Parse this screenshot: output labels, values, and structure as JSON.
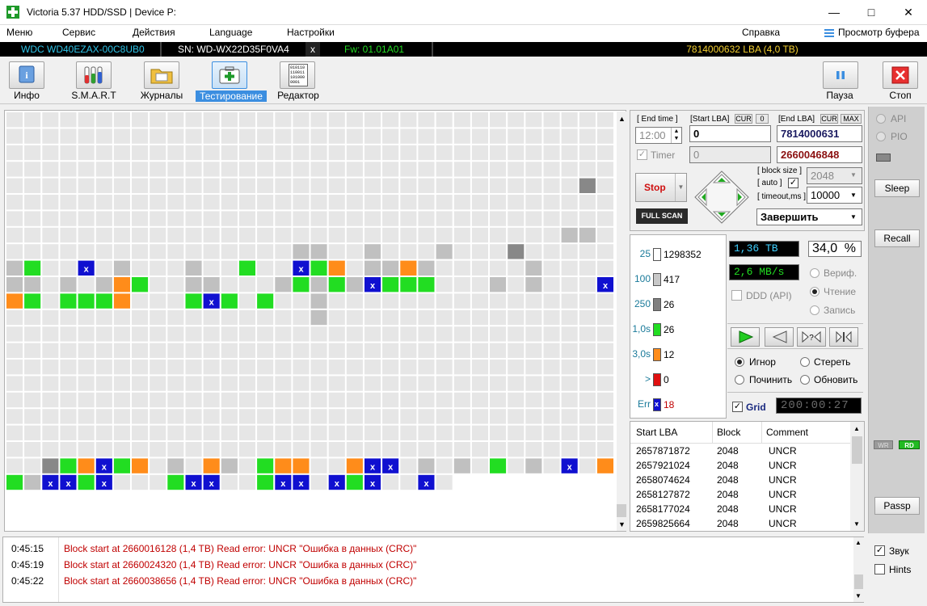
{
  "window": {
    "title": "Victoria 5.37 HDD/SSD | Device P:"
  },
  "menu": {
    "items": [
      "Меню",
      "Сервис",
      "Действия",
      "Language",
      "Настройки"
    ],
    "help": "Справка",
    "buffer": "Просмотр буфера"
  },
  "device": {
    "model": "WDC WD40EZAX-00C8UB0",
    "serial": "SN: WD-WX22D35F0VA4",
    "close": "x",
    "firmware": "Fw: 01.01A01",
    "capacity": "7814000632 LBA (4,0 TB)"
  },
  "toolbar": {
    "info": "Инфо",
    "smart": "S.M.A.R.T",
    "journals": "Журналы",
    "testing": "Тестирование",
    "editor": "Редактор",
    "pause": "Пауза",
    "stop": "Стоп",
    "editor_icon_text": "010110\n110011\n101000\n0001"
  },
  "controls": {
    "end_time_label": "[ End time ]",
    "end_time_value": "12:00",
    "start_lba_label": "[Start LBA]",
    "cur": "CUR",
    "zero": "0",
    "start_lba": "0",
    "end_lba_label": "[End LBA]",
    "max": "MAX",
    "end_lba": "7814000631",
    "timer_label": "Timer",
    "timer_value": "0",
    "current_lba": "2660046848",
    "stop_button": "Stop",
    "full_scan": "FULL SCAN",
    "block_size_label": "[ block size ]",
    "auto_label": "[ auto ]",
    "block_size": "2048",
    "timeout_label": "[ timeout,ms ]",
    "timeout": "10000",
    "finish": "Завершить"
  },
  "stats": [
    {
      "label": "25",
      "count": "1298352",
      "color": "#ffffff"
    },
    {
      "label": "100",
      "count": "417",
      "color": "#c8c8c8"
    },
    {
      "label": "250",
      "count": "26",
      "color": "#808080"
    },
    {
      "label": "1,0s",
      "count": "26",
      "color": "#22dd22"
    },
    {
      "label": "3,0s",
      "count": "12",
      "color": "#ff8c1a"
    },
    {
      "label": ">",
      "count": "0",
      "color": "#e01010"
    },
    {
      "label": "Err",
      "count": "18",
      "color": "#1010d0"
    }
  ],
  "status": {
    "done_tb": "1,36 TB",
    "percent": "34,0",
    "percent_sign": "%",
    "speed": "2,6 MB/s",
    "verify": "Вериф.",
    "read": "Чтение",
    "write": "Запись",
    "ddd": "DDD (API)",
    "ignore": "Игнор",
    "erase": "Стереть",
    "repair": "Починить",
    "refresh": "Обновить",
    "grid": "Grid",
    "elapsed": "200:00:27"
  },
  "table": {
    "headers": [
      "Start LBA",
      "Block",
      "Comment"
    ],
    "rows": [
      [
        "2657871872",
        "2048",
        "UNCR"
      ],
      [
        "2657921024",
        "2048",
        "UNCR"
      ],
      [
        "2658074624",
        "2048",
        "UNCR"
      ],
      [
        "2658127872",
        "2048",
        "UNCR"
      ],
      [
        "2658177024",
        "2048",
        "UNCR"
      ],
      [
        "2659825664",
        "2048",
        "UNCR"
      ]
    ]
  },
  "log": [
    {
      "time": "0:45:15",
      "msg": "Block start at 2660016128 (1,4 TB) Read error: UNCR \"Ошибка в данных (CRC)\""
    },
    {
      "time": "0:45:19",
      "msg": "Block start at 2660024320 (1,4 TB) Read error: UNCR \"Ошибка в данных (CRC)\""
    },
    {
      "time": "0:45:22",
      "msg": "Block start at 2660038656 (1,4 TB) Read error: UNCR \"Ошибка в данных (CRC)\""
    }
  ],
  "side": {
    "api": "API",
    "pio": "PIO",
    "sleep": "Sleep",
    "recall": "Recall",
    "wr": "WR",
    "rd": "RD",
    "passp": "Passp",
    "sound": "Звук",
    "hints": "Hints"
  },
  "colors": {
    "accent": "#3b8ee0",
    "error_text": "#c00000",
    "led_green": "#22dd22"
  },
  "grid": {
    "columns": 34,
    "rows": 23,
    "filled_rows": 22,
    "last_row_filled_cols": 25,
    "special_cells": [
      {
        "r": 4,
        "c": 32,
        "t": "g250"
      },
      {
        "r": 7,
        "c": 31,
        "t": "g100"
      },
      {
        "r": 7,
        "c": 32,
        "t": "g100"
      },
      {
        "r": 8,
        "c": 16,
        "t": "g100"
      },
      {
        "r": 8,
        "c": 17,
        "t": "g100"
      },
      {
        "r": 8,
        "c": 20,
        "t": "g100"
      },
      {
        "r": 8,
        "c": 24,
        "t": "g100"
      },
      {
        "r": 8,
        "c": 28,
        "t": "g250"
      },
      {
        "r": 9,
        "c": 0,
        "t": "g100"
      },
      {
        "r": 9,
        "c": 1,
        "t": "green"
      },
      {
        "r": 9,
        "c": 4,
        "t": "err"
      },
      {
        "r": 9,
        "c": 6,
        "t": "g100"
      },
      {
        "r": 9,
        "c": 10,
        "t": "g100"
      },
      {
        "r": 9,
        "c": 13,
        "t": "green"
      },
      {
        "r": 9,
        "c": 16,
        "t": "err"
      },
      {
        "r": 9,
        "c": 17,
        "t": "green"
      },
      {
        "r": 9,
        "c": 18,
        "t": "orange"
      },
      {
        "r": 9,
        "c": 20,
        "t": "g100"
      },
      {
        "r": 9,
        "c": 21,
        "t": "g100"
      },
      {
        "r": 9,
        "c": 22,
        "t": "orange"
      },
      {
        "r": 9,
        "c": 23,
        "t": "g100"
      },
      {
        "r": 9,
        "c": 29,
        "t": "g100"
      },
      {
        "r": 10,
        "c": 0,
        "t": "g100"
      },
      {
        "r": 10,
        "c": 1,
        "t": "g100"
      },
      {
        "r": 10,
        "c": 3,
        "t": "g100"
      },
      {
        "r": 10,
        "c": 5,
        "t": "g100"
      },
      {
        "r": 10,
        "c": 6,
        "t": "orange"
      },
      {
        "r": 10,
        "c": 7,
        "t": "green"
      },
      {
        "r": 10,
        "c": 10,
        "t": "g100"
      },
      {
        "r": 10,
        "c": 11,
        "t": "g100"
      },
      {
        "r": 10,
        "c": 15,
        "t": "g100"
      },
      {
        "r": 10,
        "c": 16,
        "t": "green"
      },
      {
        "r": 10,
        "c": 17,
        "t": "g100"
      },
      {
        "r": 10,
        "c": 18,
        "t": "green"
      },
      {
        "r": 10,
        "c": 19,
        "t": "g100"
      },
      {
        "r": 10,
        "c": 20,
        "t": "err"
      },
      {
        "r": 10,
        "c": 21,
        "t": "green"
      },
      {
        "r": 10,
        "c": 22,
        "t": "green"
      },
      {
        "r": 10,
        "c": 23,
        "t": "green"
      },
      {
        "r": 10,
        "c": 27,
        "t": "g100"
      },
      {
        "r": 10,
        "c": 29,
        "t": "g100"
      },
      {
        "r": 10,
        "c": 33,
        "t": "err"
      },
      {
        "r": 11,
        "c": 0,
        "t": "orange"
      },
      {
        "r": 11,
        "c": 1,
        "t": "green"
      },
      {
        "r": 11,
        "c": 3,
        "t": "green"
      },
      {
        "r": 11,
        "c": 4,
        "t": "green"
      },
      {
        "r": 11,
        "c": 5,
        "t": "green"
      },
      {
        "r": 11,
        "c": 6,
        "t": "orange"
      },
      {
        "r": 11,
        "c": 10,
        "t": "green"
      },
      {
        "r": 11,
        "c": 11,
        "t": "err"
      },
      {
        "r": 11,
        "c": 12,
        "t": "green"
      },
      {
        "r": 11,
        "c": 14,
        "t": "green"
      },
      {
        "r": 11,
        "c": 17,
        "t": "g100"
      },
      {
        "r": 12,
        "c": 17,
        "t": "g100"
      },
      {
        "r": 21,
        "c": 2,
        "t": "g250"
      },
      {
        "r": 21,
        "c": 3,
        "t": "green"
      },
      {
        "r": 21,
        "c": 4,
        "t": "orange"
      },
      {
        "r": 21,
        "c": 5,
        "t": "err"
      },
      {
        "r": 21,
        "c": 6,
        "t": "green"
      },
      {
        "r": 21,
        "c": 7,
        "t": "orange"
      },
      {
        "r": 21,
        "c": 9,
        "t": "g100"
      },
      {
        "r": 21,
        "c": 11,
        "t": "orange"
      },
      {
        "r": 21,
        "c": 12,
        "t": "g100"
      },
      {
        "r": 21,
        "c": 14,
        "t": "green"
      },
      {
        "r": 21,
        "c": 15,
        "t": "orange"
      },
      {
        "r": 21,
        "c": 16,
        "t": "orange"
      },
      {
        "r": 21,
        "c": 19,
        "t": "orange"
      },
      {
        "r": 21,
        "c": 20,
        "t": "err"
      },
      {
        "r": 21,
        "c": 21,
        "t": "err"
      },
      {
        "r": 21,
        "c": 23,
        "t": "g100"
      },
      {
        "r": 21,
        "c": 25,
        "t": "g100"
      },
      {
        "r": 21,
        "c": 27,
        "t": "green"
      },
      {
        "r": 21,
        "c": 29,
        "t": "g100"
      },
      {
        "r": 21,
        "c": 31,
        "t": "err"
      },
      {
        "r": 21,
        "c": 33,
        "t": "orange"
      },
      {
        "r": 22,
        "c": 0,
        "t": "green"
      },
      {
        "r": 22,
        "c": 1,
        "t": "g100"
      },
      {
        "r": 22,
        "c": 2,
        "t": "err"
      },
      {
        "r": 22,
        "c": 3,
        "t": "err"
      },
      {
        "r": 22,
        "c": 4,
        "t": "green"
      },
      {
        "r": 22,
        "c": 5,
        "t": "err"
      },
      {
        "r": 22,
        "c": 9,
        "t": "green"
      },
      {
        "r": 22,
        "c": 10,
        "t": "err"
      },
      {
        "r": 22,
        "c": 11,
        "t": "err"
      },
      {
        "r": 22,
        "c": 14,
        "t": "green"
      },
      {
        "r": 22,
        "c": 15,
        "t": "err"
      },
      {
        "r": 22,
        "c": 16,
        "t": "err"
      },
      {
        "r": 22,
        "c": 18,
        "t": "err"
      },
      {
        "r": 22,
        "c": 19,
        "t": "green"
      },
      {
        "r": 22,
        "c": 20,
        "t": "err"
      },
      {
        "r": 22,
        "c": 23,
        "t": "err"
      }
    ]
  }
}
